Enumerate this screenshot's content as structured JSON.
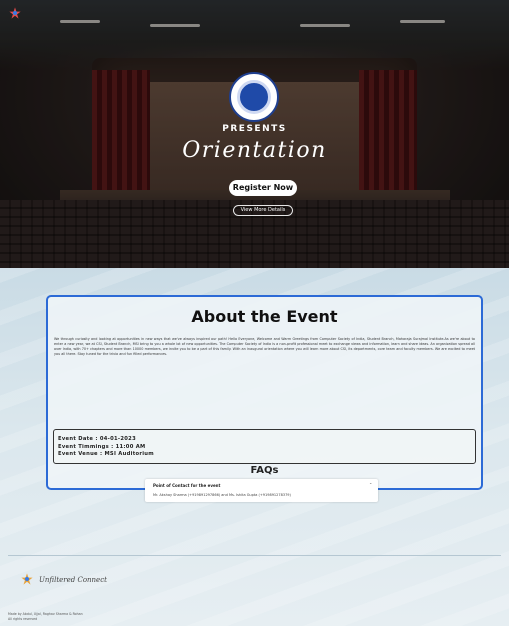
{
  "hero": {
    "presents": "PRESENTS",
    "title": "Orientation",
    "register_label": "Register Now",
    "details_label": "View More Details"
  },
  "about": {
    "title": "About the Event",
    "description": "We through curiosity and looking at opportunities in new ways that we've always inspired our path! Hello Everyone, Welcome and Warm Greetings from Computer Society of India, Student Branch, Maharaja Surajmal Institute.As we're about to enter a new year, we at CSI, Student Branch, MSI bring to you a whole lot of new opportunities. The Computer Society of India is a non-profit professional meet to exchange views and information, learn and share ideas. An organization spread all over India, with 70+ chapters and more than 10000 members, we invite you to be a part of this family. With an inaugural orientation where you will learn more about CSI, its departments, core team and faculty members. We are excited to meet you all there. Stay tuned for the trivia and fun filled performances.",
    "event_date": "Event Date : 04-01-2023",
    "event_timing": "Event Timmings : 11:00 AM",
    "event_venue": "Event Venue : MSI Auditorium"
  },
  "faqs": {
    "title": "FAQs",
    "items": [
      {
        "question": "Point of Contact for the event",
        "answer": "Mr. Akshay Sharma (+919891297866) and Ms. Ishita Gupta (+919891278379)"
      }
    ]
  },
  "footer": {
    "brand": "Unfiltered Connect",
    "credits_line1": "Made by Abdul, Ujjal, Raghav Sharma & Rohan",
    "credits_line2": "All rights reserved"
  },
  "colors": {
    "card_border": "#2c6ad6",
    "hero_dark": "#141110"
  },
  "icons": {
    "corner_logo": "csi-logo-icon",
    "emblem": "csi-emblem-icon",
    "faq_toggle": "chevron-down-icon"
  }
}
